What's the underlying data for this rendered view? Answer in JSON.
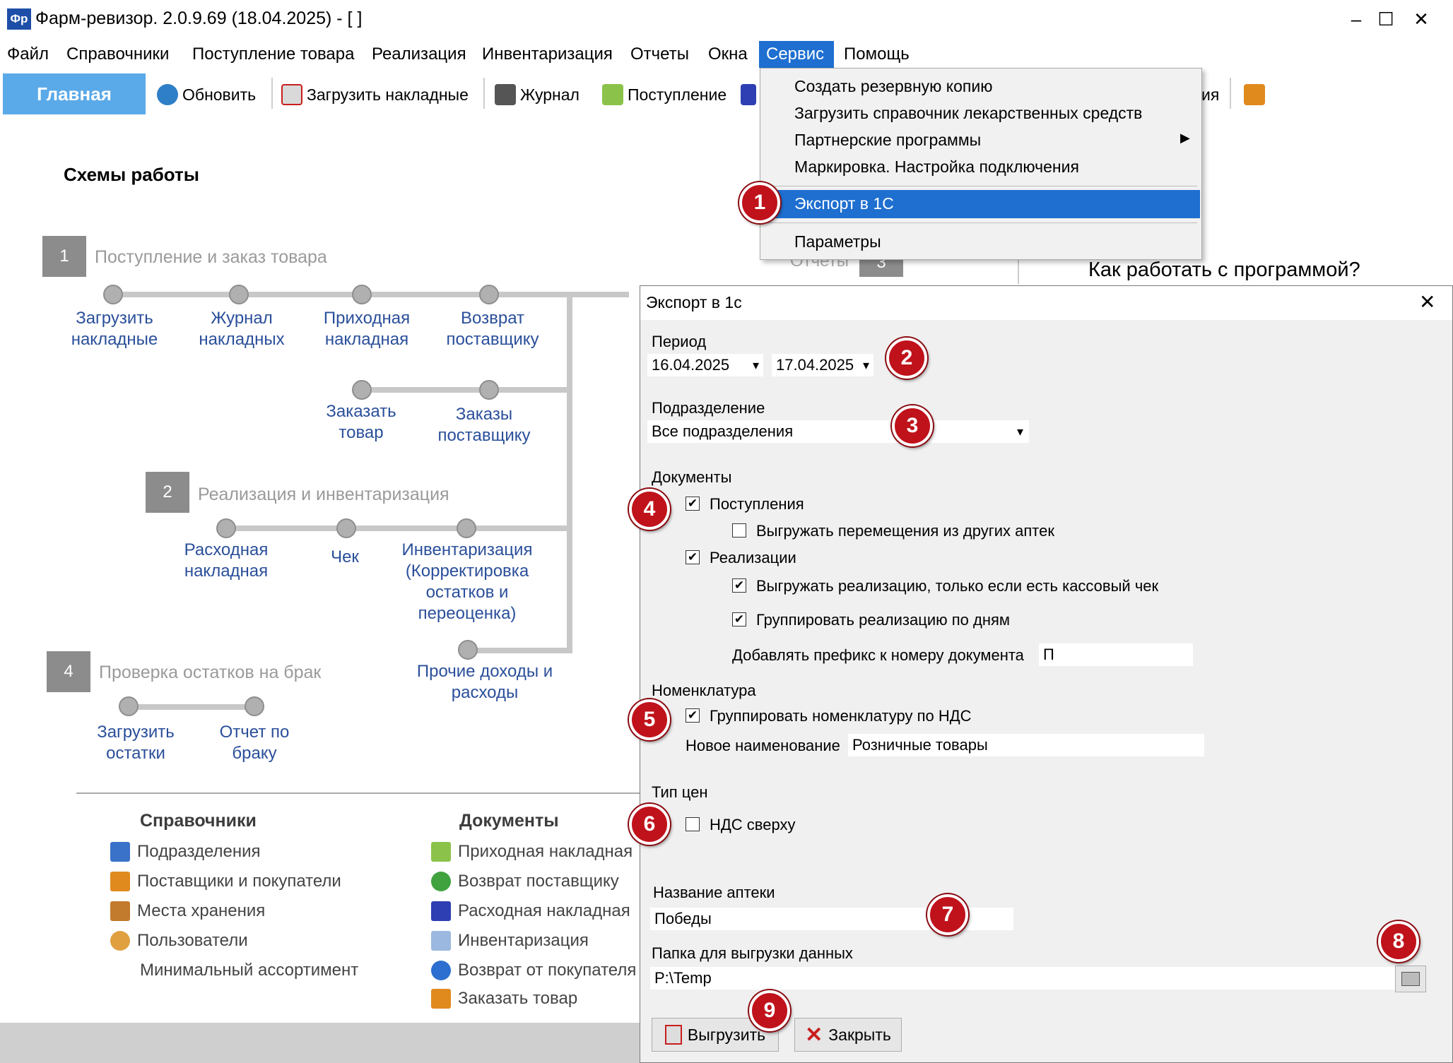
{
  "window": {
    "app_icon_text": "Фр",
    "title": "Фарм-ревизор. 2.0.9.69 (18.04.2025) - [ ]",
    "minimize": "–",
    "maximize": "☐",
    "close": "✕"
  },
  "menu": {
    "items": [
      "Файл",
      "Справочники",
      "Поступление товара",
      "Реализация",
      "Инвентаризация",
      "Отчеты",
      "Окна",
      "Сервис",
      "Помощь"
    ],
    "active": "Сервис"
  },
  "toolbar": {
    "home": "Главная",
    "refresh": "Обновить",
    "load_invoices": "Загрузить накладные",
    "journal": "Журнал",
    "receipt": "Поступление",
    "hidden_tail": "ия"
  },
  "service_menu": {
    "items": [
      "Создать резервную копию",
      "Загрузить справочник лекарственных средств",
      "Партнерские программы",
      "Маркировка. Настройка подключения",
      "Экспорт в 1С",
      "Параметры"
    ],
    "highlighted": "Экспорт в 1С",
    "submenu_arrow": "▶"
  },
  "main": {
    "heading": "Схемы работы",
    "help_title": "Как работать с программой?",
    "partial_reports": "Отчеты",
    "partial_num": "3",
    "section1": {
      "num": "1",
      "title": "Поступление и заказ товара",
      "links": [
        "Загрузить\nнакладные",
        "Журнал\nнакладных",
        "Приходная\nнакладная",
        "Возврат\nпоставщику",
        "Заказать\nтовар",
        "Заказы\nпоставщику"
      ]
    },
    "section2": {
      "num": "2",
      "title": "Реализация и инвентаризация",
      "links": [
        "Расходная\nнакладная",
        "Чек",
        "Инвентаризация\n(Корректировка\nостатков и\nпереоценка)",
        "Прочие доходы и\nрасходы"
      ]
    },
    "section4": {
      "num": "4",
      "title": "Проверка остатков на брак",
      "links": [
        "Загрузить\nостатки",
        "Отчет по\nбраку"
      ]
    },
    "refs": {
      "title": "Справочники",
      "items": [
        "Подразделения",
        "Поставщики и покупатели",
        "Места хранения",
        "Пользователи",
        "Минимальный ассортимент"
      ]
    },
    "docs": {
      "title": "Документы",
      "items": [
        "Приходная накладная",
        "Возврат поставщику",
        "Расходная накладная",
        "Инвентаризация",
        "Возврат от покупателя",
        "Заказать товар"
      ]
    }
  },
  "dialog": {
    "title": "Экспорт в 1с",
    "close": "✕",
    "period_label": "Период",
    "date_from": "16.04.2025",
    "date_to": "17.04.2025",
    "division_label": "Подразделение",
    "division_value": "Все подразделения",
    "documents_label": "Документы",
    "cb_receipts": "Поступления",
    "cb_transfers": "Выгружать перемещения из других аптек",
    "cb_sales": "Реализации",
    "cb_sales_receipt": "Выгружать реализацию, только если есть кассовый чек",
    "cb_group_days": "Группировать реализацию по дням",
    "prefix_label": "Добавлять префикс к номеру документа",
    "prefix_value": "П",
    "nomenclature_label": "Номенклатура",
    "cb_group_vat": "Группировать номенклатуру по НДС",
    "new_name_label": "Новое наименование",
    "new_name_value": "Розничные товары",
    "price_type_label": "Тип цен",
    "cb_vat_top": "НДС сверху",
    "pharmacy_label": "Название аптеки",
    "pharmacy_value": "Победы",
    "folder_label": "Папка для выгрузки данных",
    "folder_value": "P:\\Temp",
    "export_btn": "Выгрузить",
    "close_btn": "Закрыть",
    "checked_mark": "✔",
    "dropdown_arrow": "▾"
  },
  "badges": [
    "1",
    "2",
    "3",
    "4",
    "5",
    "6",
    "7",
    "8",
    "9"
  ],
  "colors": {
    "menu_highlight": "#1e6fd0",
    "home_tab": "#5aa9e8",
    "badge": "#c0121b",
    "link": "#2a4f9a"
  }
}
